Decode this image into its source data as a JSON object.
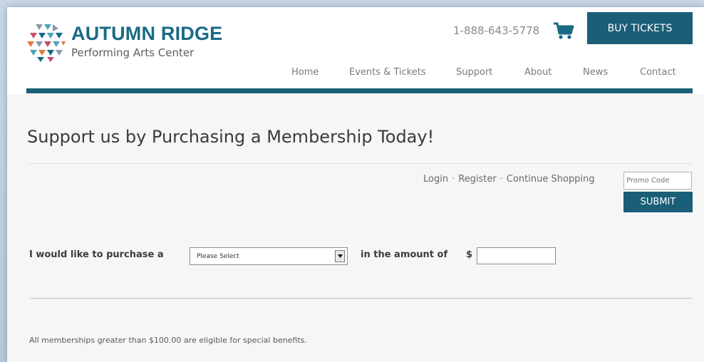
{
  "brand": {
    "name": "AUTUMN RIDGE",
    "tagline": "Performing Arts Center",
    "primary_color": "#1a5e78",
    "logo_colors": [
      "#1a6a86",
      "#4aa6b8",
      "#e07a3a",
      "#c94a6a",
      "#8a9aa8"
    ]
  },
  "header": {
    "phone": "1-888-643-5778",
    "cart_icon": "shopping-cart-icon",
    "buy_tickets_label": "BUY TICKETS"
  },
  "nav": {
    "items": [
      {
        "label": "Home"
      },
      {
        "label": "Events & Tickets"
      },
      {
        "label": "Support"
      },
      {
        "label": "About"
      },
      {
        "label": "News"
      },
      {
        "label": "Contact"
      }
    ]
  },
  "main": {
    "title": "Support us by Purchasing a Membership Today!",
    "account_links": {
      "login": "Login",
      "register": "Register",
      "continue_shopping": "Continue Shopping",
      "separator": "·"
    },
    "promo": {
      "placeholder": "Promo Code",
      "submit_label": "SUBMIT"
    },
    "purchase_form": {
      "prefix_label": "I would like to purchase a",
      "select_value": "Please Select",
      "amount_label": "in the amount of",
      "currency_symbol": "$",
      "amount_value": ""
    },
    "note": "All memberships greater than $100.00 are eligible for special benefits."
  }
}
